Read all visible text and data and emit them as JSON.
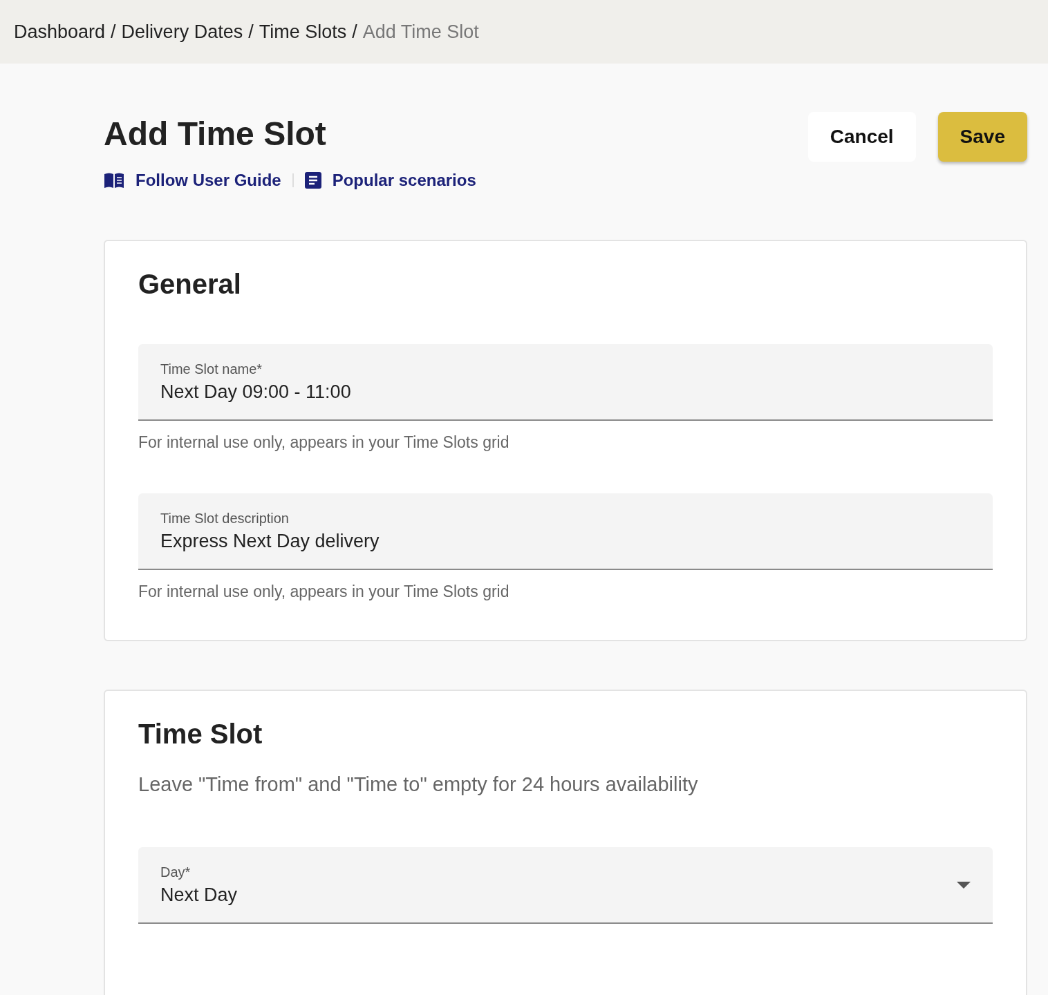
{
  "breadcrumbs": [
    {
      "label": "Dashboard",
      "current": false
    },
    {
      "label": "Delivery Dates",
      "current": false
    },
    {
      "label": "Time Slots",
      "current": false
    },
    {
      "label": "Add Time Slot",
      "current": true
    }
  ],
  "separator": "/",
  "title": "Add Time Slot",
  "links": [
    {
      "label": "Follow User Guide"
    },
    {
      "label": "Popular scenarios"
    }
  ],
  "actions": [
    {
      "label": "Cancel",
      "kind": "secondary"
    },
    {
      "label": "Save",
      "kind": "primary"
    }
  ],
  "sections": [
    {
      "title": "General",
      "fields": [
        {
          "kind": "text",
          "label": "Time Slot name*",
          "value": "Next Day 09:00 - 11:00",
          "helper": "For internal use only, appears in your Time Slots grid"
        },
        {
          "kind": "text",
          "label": "Time Slot description",
          "value": "Express Next Day delivery",
          "helper": "For internal use only, appears in your Time Slots grid"
        }
      ]
    },
    {
      "title": "Time Slot",
      "note": "Leave \"Time from\" and \"Time to\" empty for 24 hours availability",
      "fields": [
        {
          "kind": "select",
          "label": "Day*",
          "value": "Next Day"
        }
      ]
    }
  ]
}
